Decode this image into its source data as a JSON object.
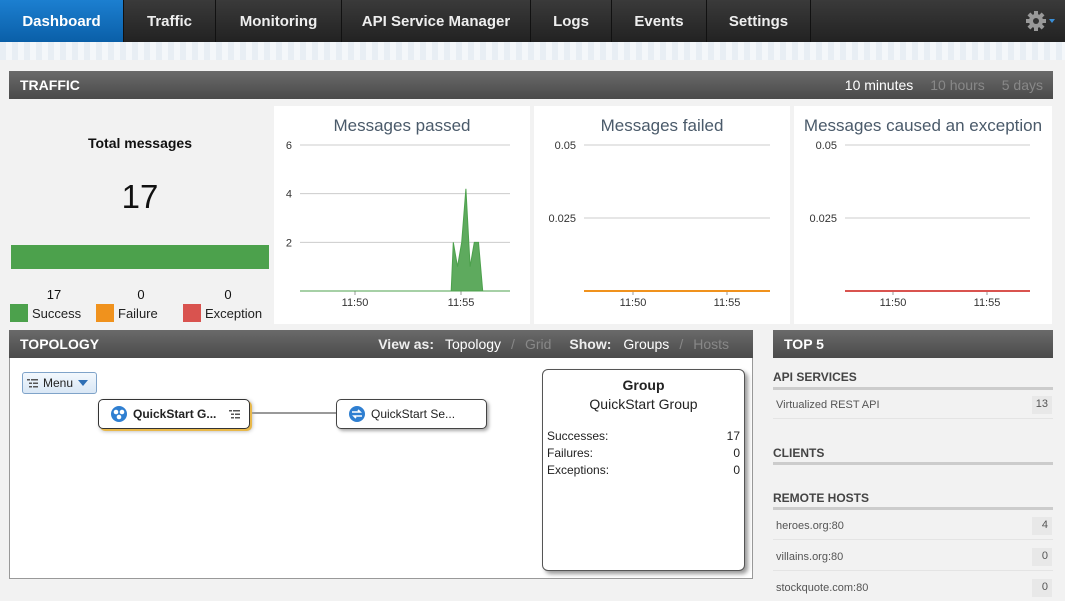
{
  "nav": {
    "tabs": [
      {
        "label": "Dashboard",
        "active": true
      },
      {
        "label": "Traffic"
      },
      {
        "label": "Monitoring"
      },
      {
        "label": "API Service Manager"
      },
      {
        "label": "Logs"
      },
      {
        "label": "Events"
      },
      {
        "label": "Settings"
      }
    ],
    "settings_icon": "gear-icon"
  },
  "traffic": {
    "title": "TRAFFIC",
    "ranges": [
      "10 minutes",
      "10 hours",
      "5 days"
    ],
    "selected_range": "10 minutes",
    "total": {
      "title": "Total messages",
      "value": "17",
      "legend": [
        {
          "label": "Success",
          "count": "17",
          "color": "#4ca14c"
        },
        {
          "label": "Failure",
          "count": "0",
          "color": "#f0921d"
        },
        {
          "label": "Exception",
          "count": "0",
          "color": "#d9534f"
        }
      ]
    },
    "charts": [
      {
        "title": "Messages passed",
        "yticks": [
          "6",
          "4",
          "2"
        ],
        "xticks": [
          "11:50",
          "11:55"
        ],
        "color": "#4ca14c"
      },
      {
        "title": "Messages failed",
        "yticks": [
          "0.05",
          "0.025"
        ],
        "xticks": [
          "11:50",
          "11:55"
        ],
        "color": "#f0921d"
      },
      {
        "title": "Messages caused an exception",
        "yticks": [
          "0.05",
          "0.025"
        ],
        "xticks": [
          "11:50",
          "11:55"
        ],
        "color": "#d9534f"
      }
    ]
  },
  "chart_data": [
    {
      "type": "area",
      "title": "Messages passed",
      "x": [
        "11:47",
        "11:48",
        "11:49",
        "11:50",
        "11:51",
        "11:52",
        "11:53",
        "11:54",
        "11:54:20",
        "11:54:30",
        "11:54:40",
        "11:54:50",
        "11:55",
        "11:55:10",
        "11:55:20",
        "11:55:30",
        "11:55:40",
        "11:56",
        "11:57"
      ],
      "values": [
        0,
        0,
        0,
        0,
        0,
        0,
        0,
        0,
        2,
        1,
        2,
        4.2,
        1,
        2,
        2,
        0,
        0,
        0,
        0
      ],
      "ylim": [
        0,
        6
      ],
      "xticks": [
        "11:50",
        "11:55"
      ],
      "grid": true
    },
    {
      "type": "line",
      "title": "Messages failed",
      "values": [
        0,
        0
      ],
      "ylim": [
        0,
        0.05
      ],
      "xticks": [
        "11:50",
        "11:55"
      ],
      "grid": true
    },
    {
      "type": "line",
      "title": "Messages caused an exception",
      "values": [
        0,
        0
      ],
      "ylim": [
        0,
        0.05
      ],
      "xticks": [
        "11:50",
        "11:55"
      ],
      "grid": true
    }
  ],
  "topology": {
    "title": "TOPOLOGY",
    "view_as_label": "View as:",
    "view_options": [
      "Topology",
      "Grid"
    ],
    "show_label": "Show:",
    "show_options": [
      "Groups",
      "Hosts"
    ],
    "separator": "/",
    "menu_label": "Menu",
    "nodes": [
      {
        "label": "QuickStart G...",
        "icon": "group-icon"
      },
      {
        "label": "QuickStart Se...",
        "icon": "service-icon"
      }
    ],
    "info": {
      "title": "Group",
      "subtitle": "QuickStart Group",
      "rows": [
        {
          "label": "Successes:",
          "value": "17"
        },
        {
          "label": "Failures:",
          "value": "0"
        },
        {
          "label": "Exceptions:",
          "value": "0"
        }
      ]
    }
  },
  "top5": {
    "title": "TOP 5",
    "api_services": {
      "title": "API SERVICES",
      "items": [
        {
          "label": "Virtualized REST API",
          "count": "13"
        }
      ]
    },
    "clients": {
      "title": "CLIENTS"
    },
    "remote_hosts": {
      "title": "REMOTE HOSTS",
      "items": [
        {
          "label": "heroes.org:80",
          "count": "4"
        },
        {
          "label": "villains.org:80",
          "count": "0"
        },
        {
          "label": "stockquote.com:80",
          "count": "0"
        }
      ]
    }
  }
}
